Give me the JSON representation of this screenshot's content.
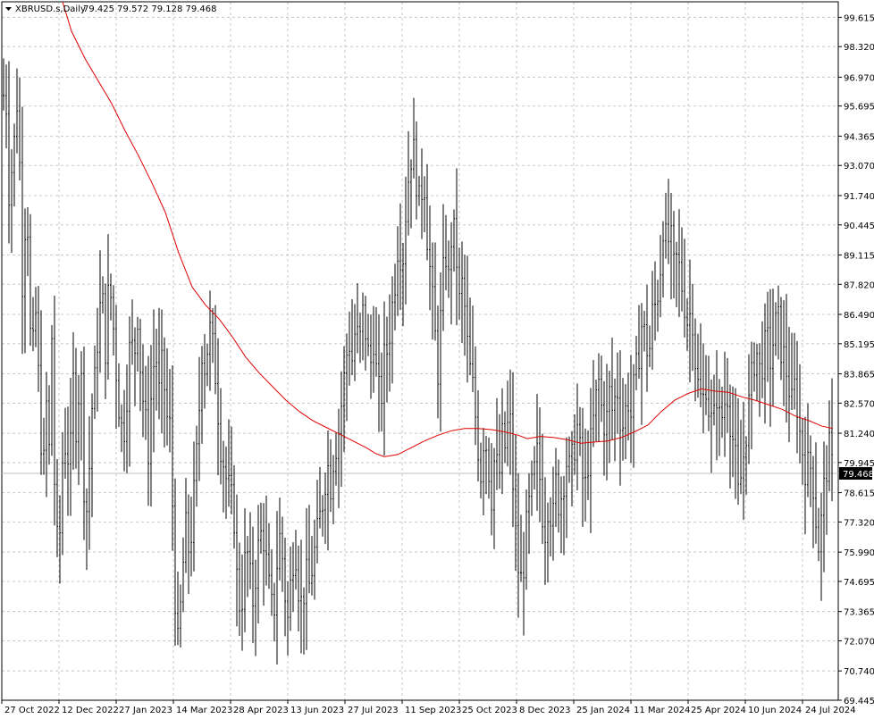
{
  "header": {
    "symbol_label": "XBRUSD.s,Daily",
    "ohlc": "79.425 79.572 79.128 79.468"
  },
  "colors": {
    "background": "#ffffff",
    "grid": "#c8c8c8",
    "bars": "#000000",
    "ma_line": "#e00000",
    "price_tag_bg": "#000000",
    "price_tag_text": "#ffffff",
    "current_price_line": "#c0c0c0"
  },
  "chart_data": {
    "type": "line",
    "title": "XBRUSD.s,Daily",
    "xlabel": "",
    "ylabel": "",
    "ylim": [
      69.445,
      100.3
    ],
    "grid": true,
    "y_ticks": [
      "99.615",
      "98.320",
      "96.970",
      "95.695",
      "94.365",
      "93.070",
      "91.740",
      "90.445",
      "89.115",
      "87.820",
      "86.490",
      "85.195",
      "83.865",
      "82.570",
      "81.240",
      "79.945",
      "78.615",
      "77.320",
      "75.990",
      "74.695",
      "73.365",
      "72.070",
      "70.740",
      "69.445"
    ],
    "x_ticks": [
      "27 Oct 2022",
      "12 Dec 2022",
      "27 Jan 2023",
      "14 Mar 2023",
      "28 Apr 2023",
      "13 Jun 2023",
      "27 Jul 2023",
      "11 Sep 2023",
      "25 Oct 2023",
      "8 Dec 2023",
      "25 Jan 2024",
      "11 Mar 2024",
      "25 Apr 2024",
      "10 Jun 2024",
      "24 Jul 2024"
    ],
    "current_price": 79.468,
    "current_price_label": "79.468",
    "series": [
      {
        "kind": "price-bars",
        "points": [
          [
            0,
            94.5
          ],
          [
            6,
            97.0
          ],
          [
            10,
            92.0
          ],
          [
            15,
            93.5
          ],
          [
            20,
            96.5
          ],
          [
            25,
            88.0
          ],
          [
            30,
            92.0
          ],
          [
            35,
            84.0
          ],
          [
            40,
            86.5
          ],
          [
            45,
            82.0
          ],
          [
            48,
            79.0
          ],
          [
            52,
            82.5
          ],
          [
            55,
            80.5
          ],
          [
            58,
            85.5
          ],
          [
            62,
            77.0
          ],
          [
            66,
            75.8
          ],
          [
            70,
            80.0
          ],
          [
            74,
            81.0
          ],
          [
            78,
            79.5
          ],
          [
            82,
            83.5
          ],
          [
            86,
            81.0
          ],
          [
            90,
            85.0
          ],
          [
            94,
            79.0
          ],
          [
            98,
            77.5
          ],
          [
            102,
            82.0
          ],
          [
            106,
            83.5
          ],
          [
            110,
            86.0
          ],
          [
            114,
            87.5
          ],
          [
            118,
            85.0
          ],
          [
            122,
            88.0
          ],
          [
            126,
            86.5
          ],
          [
            130,
            84.0
          ],
          [
            134,
            82.0
          ],
          [
            138,
            81.0
          ],
          [
            142,
            83.0
          ],
          [
            146,
            85.5
          ],
          [
            150,
            84.5
          ],
          [
            154,
            86.5
          ],
          [
            158,
            83.5
          ],
          [
            162,
            82.0
          ],
          [
            166,
            80.5
          ],
          [
            170,
            83.5
          ],
          [
            174,
            85.0
          ],
          [
            178,
            83.0
          ],
          [
            182,
            84.5
          ],
          [
            186,
            82.0
          ],
          [
            190,
            81.5
          ],
          [
            194,
            77.0
          ],
          [
            197,
            72.5
          ],
          [
            200,
            71.5
          ],
          [
            203,
            74.5
          ],
          [
            206,
            76.0
          ],
          [
            209,
            77.5
          ],
          [
            212,
            75.5
          ],
          [
            215,
            77.5
          ],
          [
            218,
            79.0
          ],
          [
            222,
            81.5
          ],
          [
            226,
            85.0
          ],
          [
            230,
            84.0
          ],
          [
            234,
            86.0
          ],
          [
            238,
            85.0
          ],
          [
            242,
            83.5
          ],
          [
            246,
            81.0
          ],
          [
            250,
            80.0
          ],
          [
            254,
            79.0
          ],
          [
            258,
            78.5
          ],
          [
            262,
            77.5
          ],
          [
            266,
            74.0
          ],
          [
            270,
            73.5
          ],
          [
            274,
            75.5
          ],
          [
            278,
            76.0
          ],
          [
            282,
            73.5
          ],
          [
            286,
            75.0
          ],
          [
            290,
            76.5
          ],
          [
            294,
            77.0
          ],
          [
            298,
            75.5
          ],
          [
            302,
            74.0
          ],
          [
            306,
            73.0
          ],
          [
            310,
            75.5
          ],
          [
            314,
            77.0
          ],
          [
            318,
            74.5
          ],
          [
            322,
            73.0
          ],
          [
            326,
            75.0
          ],
          [
            330,
            76.5
          ],
          [
            334,
            74.5
          ],
          [
            338,
            73.5
          ],
          [
            342,
            75.0
          ],
          [
            346,
            74.5
          ],
          [
            350,
            75.5
          ],
          [
            354,
            76.5
          ],
          [
            358,
            77.5
          ],
          [
            362,
            78.5
          ],
          [
            366,
            80.0
          ],
          [
            370,
            79.0
          ],
          [
            374,
            80.5
          ],
          [
            378,
            81.0
          ],
          [
            382,
            82.5
          ],
          [
            386,
            84.0
          ],
          [
            390,
            85.5
          ],
          [
            394,
            84.5
          ],
          [
            398,
            86.0
          ],
          [
            402,
            85.0
          ],
          [
            406,
            86.5
          ],
          [
            410,
            85.5
          ],
          [
            414,
            84.0
          ],
          [
            418,
            85.5
          ],
          [
            422,
            83.5
          ],
          [
            426,
            82.5
          ],
          [
            430,
            84.5
          ],
          [
            434,
            85.0
          ],
          [
            438,
            86.5
          ],
          [
            442,
            88.0
          ],
          [
            446,
            90.0
          ],
          [
            450,
            88.5
          ],
          [
            454,
            91.0
          ],
          [
            458,
            93.0
          ],
          [
            462,
            94.0
          ],
          [
            466,
            92.5
          ],
          [
            470,
            91.0
          ],
          [
            474,
            93.0
          ],
          [
            478,
            90.0
          ],
          [
            482,
            88.0
          ],
          [
            486,
            86.0
          ],
          [
            490,
            84.0
          ],
          [
            494,
            87.0
          ],
          [
            498,
            89.5
          ],
          [
            502,
            88.0
          ],
          [
            506,
            90.5
          ],
          [
            510,
            89.5
          ],
          [
            514,
            87.0
          ],
          [
            518,
            88.0
          ],
          [
            522,
            85.5
          ],
          [
            526,
            84.0
          ],
          [
            530,
            83.0
          ],
          [
            534,
            81.0
          ],
          [
            538,
            79.5
          ],
          [
            542,
            81.5
          ],
          [
            546,
            80.0
          ],
          [
            550,
            78.5
          ],
          [
            554,
            80.5
          ],
          [
            558,
            79.0
          ],
          [
            562,
            81.0
          ],
          [
            566,
            80.5
          ],
          [
            570,
            82.5
          ],
          [
            574,
            79.0
          ],
          [
            578,
            76.0
          ],
          [
            582,
            74.5
          ],
          [
            586,
            75.5
          ],
          [
            590,
            77.5
          ],
          [
            594,
            78.5
          ],
          [
            598,
            79.5
          ],
          [
            602,
            80.5
          ],
          [
            606,
            78.0
          ],
          [
            610,
            77.0
          ],
          [
            614,
            78.5
          ],
          [
            618,
            77.0
          ],
          [
            622,
            79.0
          ],
          [
            626,
            78.0
          ],
          [
            630,
            79.0
          ],
          [
            634,
            80.0
          ],
          [
            638,
            79.5
          ],
          [
            642,
            80.5
          ],
          [
            646,
            81.5
          ],
          [
            650,
            80.0
          ],
          [
            654,
            78.5
          ],
          [
            658,
            80.0
          ],
          [
            662,
            81.0
          ],
          [
            666,
            82.5
          ],
          [
            670,
            83.5
          ],
          [
            674,
            82.0
          ],
          [
            678,
            81.5
          ],
          [
            682,
            83.0
          ],
          [
            686,
            82.0
          ],
          [
            690,
            83.5
          ],
          [
            694,
            82.0
          ],
          [
            698,
            81.5
          ],
          [
            702,
            83.0
          ],
          [
            706,
            82.0
          ],
          [
            710,
            83.5
          ],
          [
            714,
            84.5
          ],
          [
            718,
            86.0
          ],
          [
            722,
            85.5
          ],
          [
            726,
            84.5
          ],
          [
            730,
            86.5
          ],
          [
            734,
            87.0
          ],
          [
            738,
            88.0
          ],
          [
            742,
            90.5
          ],
          [
            746,
            89.5
          ],
          [
            750,
            90.0
          ],
          [
            754,
            88.5
          ],
          [
            758,
            89.0
          ],
          [
            762,
            88.0
          ],
          [
            766,
            87.0
          ],
          [
            770,
            86.0
          ],
          [
            774,
            87.0
          ],
          [
            778,
            84.5
          ],
          [
            782,
            83.0
          ],
          [
            786,
            82.5
          ],
          [
            790,
            83.5
          ],
          [
            794,
            82.0
          ],
          [
            798,
            81.5
          ],
          [
            802,
            83.0
          ],
          [
            806,
            81.5
          ],
          [
            810,
            82.5
          ],
          [
            814,
            83.0
          ],
          [
            818,
            81.5
          ],
          [
            822,
            80.5
          ],
          [
            826,
            78.5
          ],
          [
            830,
            79.5
          ],
          [
            834,
            81.0
          ],
          [
            838,
            82.5
          ],
          [
            842,
            84.0
          ],
          [
            846,
            85.0
          ],
          [
            850,
            84.0
          ],
          [
            854,
            84.5
          ],
          [
            858,
            85.5
          ],
          [
            862,
            84.5
          ],
          [
            866,
            85.5
          ],
          [
            870,
            86.5
          ],
          [
            874,
            85.0
          ],
          [
            878,
            84.5
          ],
          [
            882,
            83.5
          ],
          [
            886,
            82.5
          ],
          [
            890,
            83.5
          ],
          [
            894,
            81.5
          ],
          [
            898,
            80.5
          ],
          [
            902,
            79.5
          ],
          [
            906,
            80.0
          ],
          [
            910,
            79.0
          ],
          [
            914,
            77.0
          ],
          [
            917,
            76.0
          ],
          [
            920,
            78.0
          ],
          [
            924,
            79.5
          ],
          [
            928,
            80.5
          ],
          [
            932,
            79.468
          ]
        ]
      },
      {
        "kind": "moving-average",
        "points": [
          [
            70,
            100.3
          ],
          [
            80,
            99.0
          ],
          [
            95,
            97.8
          ],
          [
            110,
            96.8
          ],
          [
            125,
            95.8
          ],
          [
            140,
            94.6
          ],
          [
            155,
            93.5
          ],
          [
            170,
            92.3
          ],
          [
            185,
            91.0
          ],
          [
            200,
            89.2
          ],
          [
            215,
            87.7
          ],
          [
            230,
            86.9
          ],
          [
            245,
            86.3
          ],
          [
            260,
            85.5
          ],
          [
            275,
            84.6
          ],
          [
            290,
            83.9
          ],
          [
            305,
            83.3
          ],
          [
            320,
            82.7
          ],
          [
            335,
            82.2
          ],
          [
            350,
            81.8
          ],
          [
            365,
            81.5
          ],
          [
            380,
            81.2
          ],
          [
            395,
            80.9
          ],
          [
            410,
            80.6
          ],
          [
            420,
            80.35
          ],
          [
            430,
            80.2
          ],
          [
            445,
            80.3
          ],
          [
            460,
            80.6
          ],
          [
            475,
            80.9
          ],
          [
            490,
            81.15
          ],
          [
            505,
            81.35
          ],
          [
            520,
            81.45
          ],
          [
            535,
            81.45
          ],
          [
            550,
            81.4
          ],
          [
            565,
            81.3
          ],
          [
            580,
            81.15
          ],
          [
            590,
            81.0
          ],
          [
            605,
            81.1
          ],
          [
            620,
            81.05
          ],
          [
            635,
            80.95
          ],
          [
            650,
            80.8
          ],
          [
            665,
            80.85
          ],
          [
            680,
            80.9
          ],
          [
            695,
            81.05
          ],
          [
            710,
            81.3
          ],
          [
            725,
            81.6
          ],
          [
            740,
            82.2
          ],
          [
            755,
            82.7
          ],
          [
            770,
            83.0
          ],
          [
            785,
            83.2
          ],
          [
            800,
            83.1
          ],
          [
            815,
            83.05
          ],
          [
            830,
            82.85
          ],
          [
            845,
            82.7
          ],
          [
            860,
            82.5
          ],
          [
            875,
            82.3
          ],
          [
            890,
            82.0
          ],
          [
            905,
            81.8
          ],
          [
            920,
            81.55
          ],
          [
            932,
            81.45
          ]
        ]
      }
    ]
  }
}
